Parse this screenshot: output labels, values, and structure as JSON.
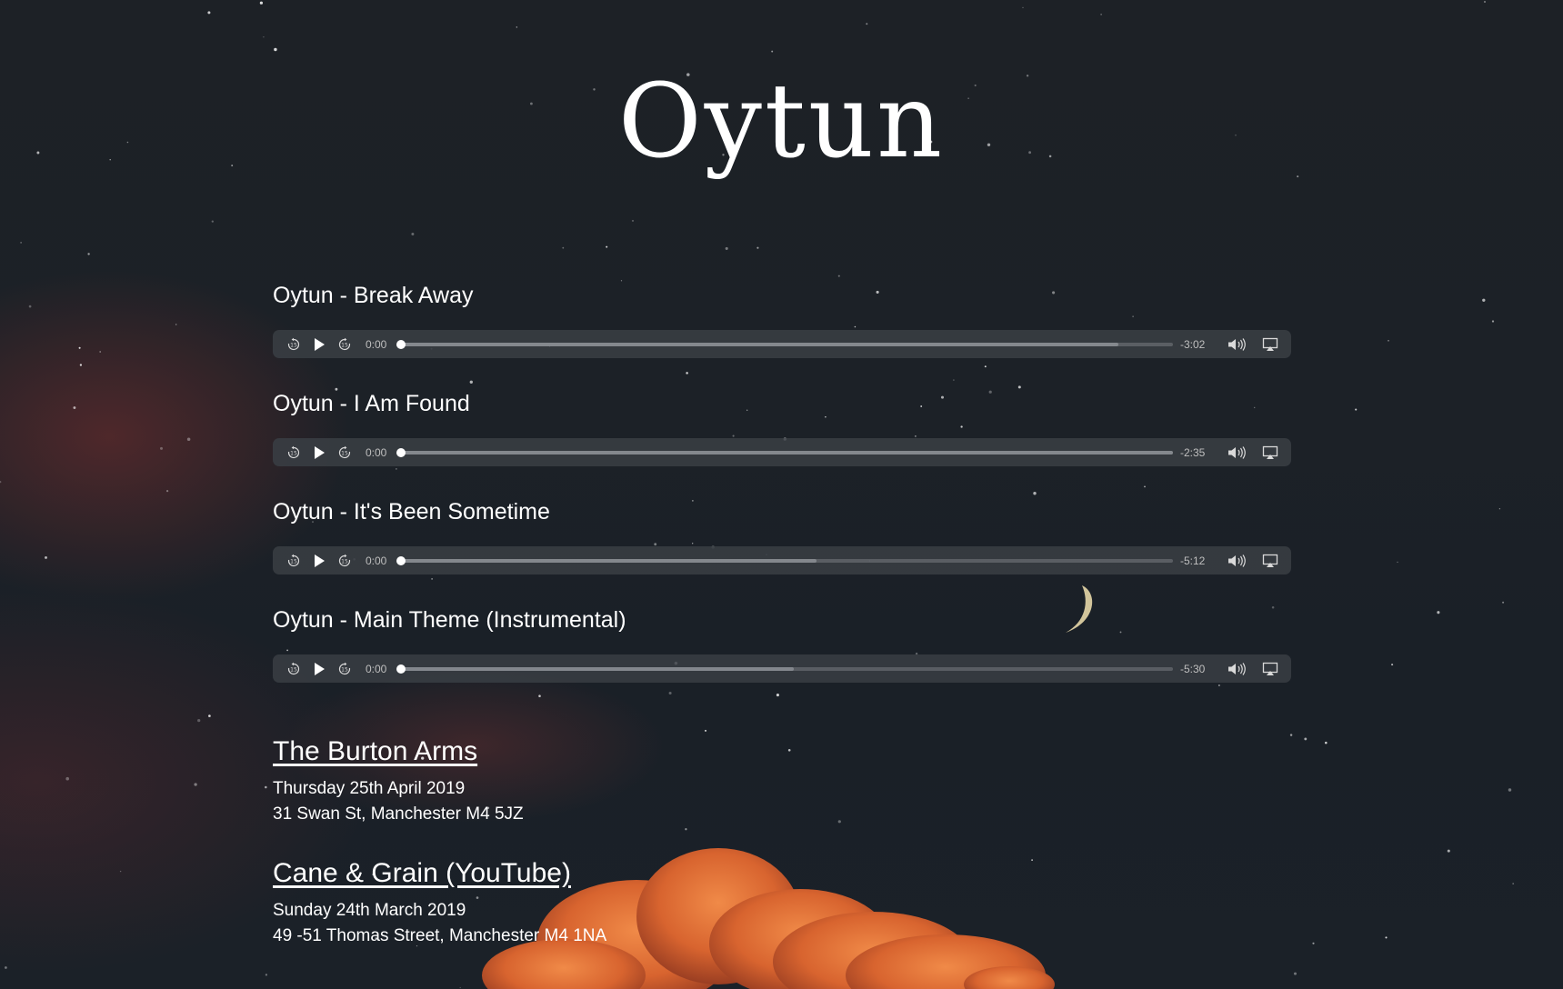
{
  "page": {
    "title": "Oytun",
    "colors": {
      "background": "#1c2127",
      "text": "#ffffff",
      "player_bar": "#3a3e44",
      "cloud": "#e0703a"
    }
  },
  "tracks": [
    {
      "title": "Oytun - Break Away",
      "current_time": "0:00",
      "remaining_time": "-3:02",
      "progress": 0,
      "buffered": 0.93
    },
    {
      "title": "Oytun - I Am Found",
      "current_time": "0:00",
      "remaining_time": "-2:35",
      "progress": 0,
      "buffered": 1.0
    },
    {
      "title": "Oytun - It's Been Sometime",
      "current_time": "0:00",
      "remaining_time": "-5:12",
      "progress": 0,
      "buffered": 0.54
    },
    {
      "title": "Oytun - Main Theme (Instrumental)",
      "current_time": "0:00",
      "remaining_time": "-5:30",
      "progress": 0,
      "buffered": 0.51
    }
  ],
  "player_icons": {
    "skip_back": "skip-back-15-icon",
    "play": "play-icon",
    "skip_forward": "skip-forward-15-icon",
    "volume": "volume-icon",
    "airplay": "airplay-icon"
  },
  "events": [
    {
      "name": "The Burton Arms",
      "date": "Thursday 25th April 2019",
      "address": "31 Swan St, Manchester M4 5JZ"
    },
    {
      "name": "Cane & Grain (YouTube)",
      "date": "Sunday 24th March 2019",
      "address": "49 -51 Thomas Street, Manchester M4 1NA"
    }
  ]
}
